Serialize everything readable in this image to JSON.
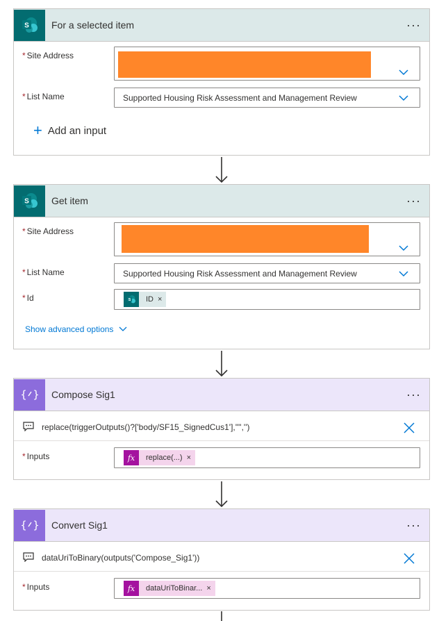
{
  "cards": {
    "trigger": {
      "title": "For a selected item",
      "more": "···",
      "site_address_label": "Site Address",
      "list_name_label": "List Name",
      "list_name_value": "Supported Housing Risk Assessment and Management Review",
      "add_input": "Add an input"
    },
    "get_item": {
      "title": "Get item",
      "more": "···",
      "site_address_label": "Site Address",
      "list_name_label": "List Name",
      "list_name_value": "Supported Housing Risk Assessment and Management Review",
      "id_label": "Id",
      "id_token": "ID",
      "advanced": "Show advanced options"
    },
    "compose_sig1": {
      "title": "Compose Sig1",
      "more": "···",
      "expression": "replace(triggerOutputs()?['body/SF15_SignedCus1'],'\"','')",
      "inputs_label": "Inputs",
      "inputs_token": "replace(...)"
    },
    "convert_sig1": {
      "title": "Convert Sig1",
      "more": "···",
      "expression": "dataUriToBinary(outputs('Compose_Sig1'))",
      "inputs_label": "Inputs",
      "inputs_token": "dataUriToBinar..."
    }
  },
  "symbols": {
    "required": "*",
    "remove": "×",
    "fx": "fx",
    "plus": "+"
  },
  "colors": {
    "sharepoint_teal": "#036c70",
    "sharepoint_header": "#dce9e9",
    "compose_purple": "#8c6cdc",
    "compose_header": "#ece6fa",
    "link_blue": "#0078d4",
    "redaction_orange": "#ff8629",
    "fx_magenta": "#a4129f"
  },
  "icons": [
    "sharepoint-icon",
    "compose-icon",
    "chevron-down-icon",
    "comment-icon",
    "close-icon",
    "arrow-down-icon",
    "fx-icon",
    "plus-icon"
  ]
}
